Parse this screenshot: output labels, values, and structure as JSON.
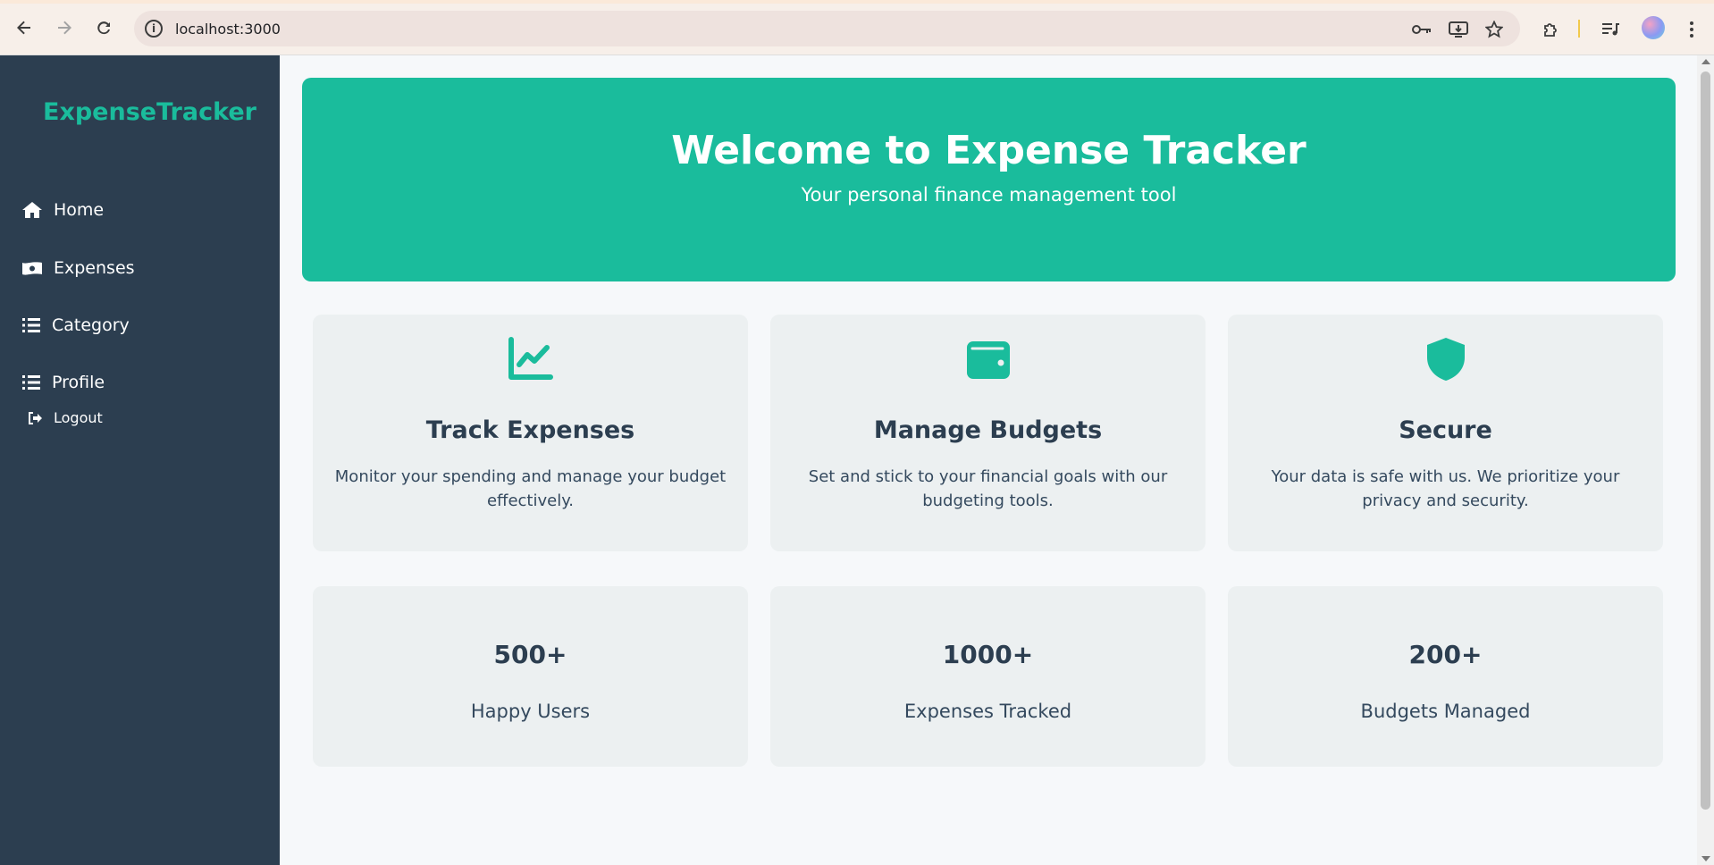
{
  "browser": {
    "url": "localhost:3000"
  },
  "sidebar": {
    "brand": "ExpenseTracker",
    "items": [
      {
        "label": "Home",
        "icon": "home-icon"
      },
      {
        "label": "Expenses",
        "icon": "money-icon"
      },
      {
        "label": "Category",
        "icon": "list-icon"
      },
      {
        "label": "Profile",
        "icon": "list-icon"
      },
      {
        "label": "Logout",
        "icon": "logout-icon"
      }
    ]
  },
  "hero": {
    "title": "Welcome to Expense Tracker",
    "subtitle": "Your personal finance management tool"
  },
  "features": [
    {
      "icon": "chart-line-icon",
      "title": "Track Expenses",
      "description": "Monitor your spending and manage your budget effectively."
    },
    {
      "icon": "wallet-icon",
      "title": "Manage Budgets",
      "description": "Set and stick to your financial goals with our budgeting tools."
    },
    {
      "icon": "shield-icon",
      "title": "Secure",
      "description": "Your data is safe with us. We prioritize your privacy and security."
    }
  ],
  "stats": [
    {
      "value": "500+",
      "label": "Happy Users"
    },
    {
      "value": "1000+",
      "label": "Expenses Tracked"
    },
    {
      "value": "200+",
      "label": "Budgets Managed"
    }
  ],
  "colors": {
    "accent": "#1abc9c",
    "sidebar": "#2c3e50",
    "card": "#ecf0f1"
  }
}
